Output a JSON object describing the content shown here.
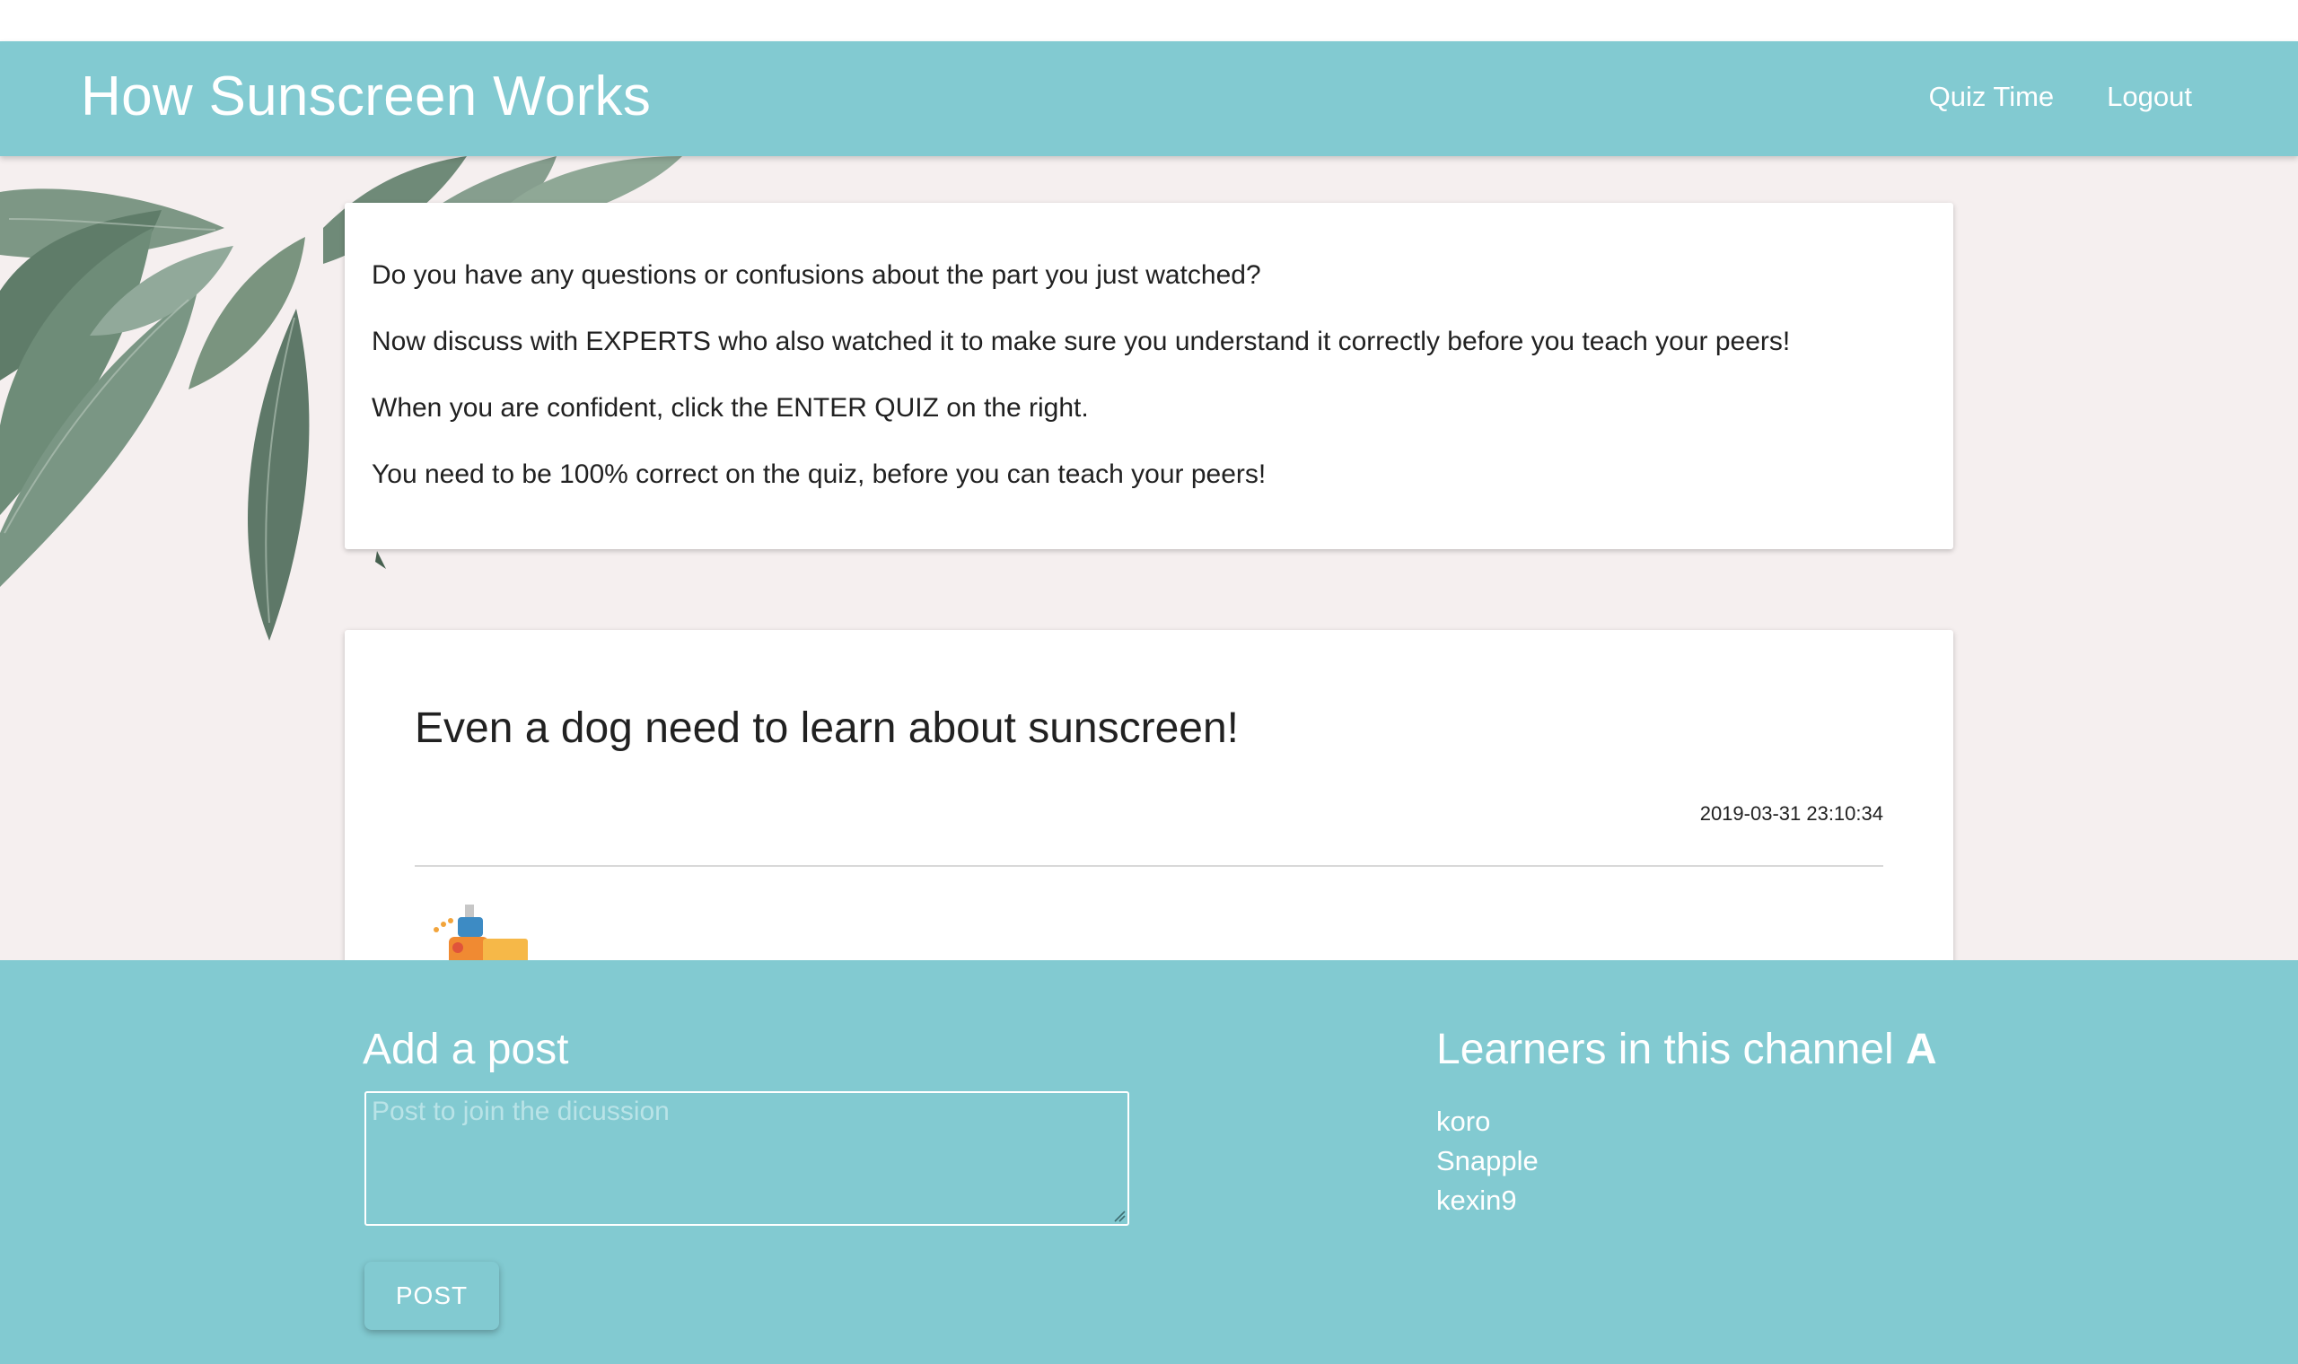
{
  "header": {
    "title": "How Sunscreen Works",
    "nav": [
      {
        "label": "Quiz Time"
      },
      {
        "label": "Logout"
      }
    ]
  },
  "info": {
    "lines": [
      "Do you have any questions or confusions about the part you just watched?",
      "Now discuss with EXPERTS who also watched it to make sure you understand it correctly before you teach your peers!",
      "When you are confident, click the ENTER QUIZ on the right.",
      "You need to be 100% correct on the quiz, before you can teach your peers!"
    ]
  },
  "post": {
    "title": "Even a dog need to learn about sunscreen!",
    "timestamp": "2019-03-31 23:10:34"
  },
  "add_post": {
    "heading": "Add a post",
    "placeholder": "Post to join the dicussion",
    "button_label": "POST"
  },
  "learners": {
    "heading_prefix": "Learners in this channel",
    "channel": "A",
    "names": [
      "koro",
      "Snapple",
      "kexin9"
    ]
  },
  "colors": {
    "accent": "#82cad1",
    "backdrop": "#f5efef",
    "card": "#ffffff",
    "text": "#212121"
  },
  "icons": {
    "post_image": "sunscreen-illustration",
    "decoration": "leaves-decoration"
  }
}
